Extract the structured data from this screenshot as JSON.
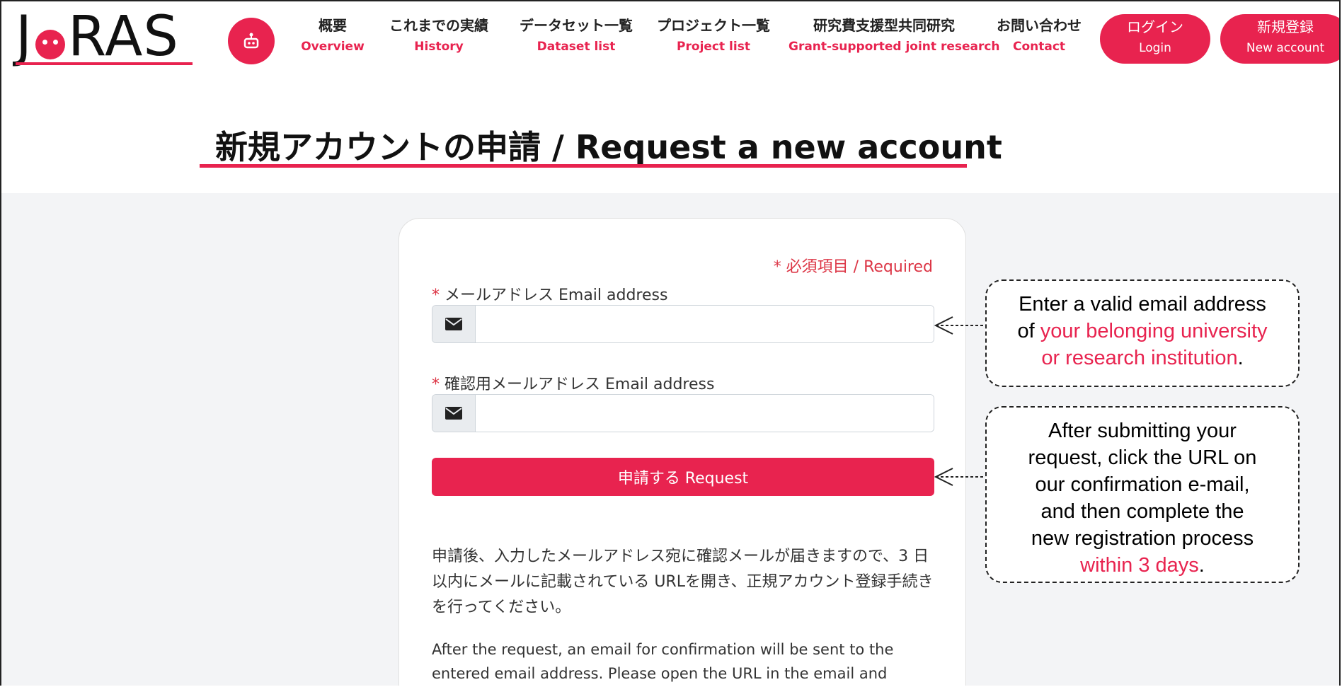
{
  "header": {
    "logo": "JoRAS",
    "nav": [
      {
        "ja": "概要",
        "en": "Overview"
      },
      {
        "ja": "これまでの実績",
        "en": "History"
      },
      {
        "ja": "データセット一覧",
        "en": "Dataset list"
      },
      {
        "ja": "プロジェクト一覧",
        "en": "Project list"
      },
      {
        "ja": "研究費支援型共同研究",
        "en": "Grant-supported joint research"
      },
      {
        "ja": "お問い合わせ",
        "en": "Contact"
      }
    ],
    "login": {
      "ja": "ログイン",
      "en": "Login"
    },
    "signup": {
      "ja": "新規登録",
      "en": "New account"
    }
  },
  "page_title": "新規アカウントの申請 / Request a new account",
  "form": {
    "required_note": "* 必須項目 / Required",
    "email_label": "メールアドレス Email address",
    "email_value": "",
    "confirm_label": "確認用メールアドレス Email address",
    "confirm_value": "",
    "required_star": "*",
    "submit_label": "申請する Request",
    "help_ja": "申請後、入力したメールアドレス宛に確認メールが届きますので、3 日以内にメールに記載されている URLを開き、正規アカウント登録手続きを行ってください。",
    "help_en": "After the request, an email for confirmation will be sent to the entered email address. Please open the URL in the email and"
  },
  "callouts": {
    "email": {
      "line1": "Enter a valid email address",
      "of": "of ",
      "hl1": "your belonging university",
      "hl2": "or research institution",
      "period": "."
    },
    "request": {
      "line1": "After submitting your",
      "line2": "request, click the URL on",
      "line3": "our confirmation e-mail,",
      "line4": "and then complete the",
      "line5": "new registration process",
      "hl": "within 3 days",
      "period": "."
    }
  },
  "colors": {
    "accent": "#e8234f",
    "required": "#dc3545",
    "background": "#f3f4f6"
  },
  "icons": [
    "robot-icon",
    "envelope-icon",
    "arrow-left-icon"
  ]
}
